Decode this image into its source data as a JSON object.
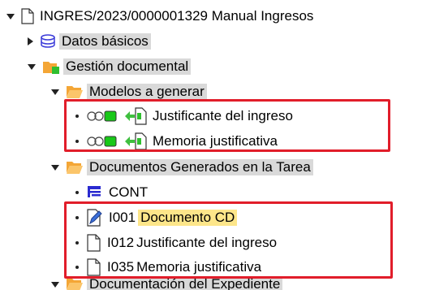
{
  "tree": {
    "root": {
      "label": "INGRES/2023/0000001329 Manual Ingresos",
      "icon": "document-icon"
    },
    "datos_basicos": {
      "label": "Datos básicos",
      "icon": "database-icon"
    },
    "gestion": {
      "label": "Gestión documental",
      "icon": "folder-orange-green-icon"
    },
    "modelos": {
      "label": "Modelos a generar",
      "icon": "folder-open-icon"
    },
    "modelos_items": [
      {
        "label": "Justificante del ingreso",
        "icon": "generate-document-icon"
      },
      {
        "label": "Memoria justificativa",
        "icon": "generate-document-icon"
      }
    ],
    "documentos": {
      "label": "Documentos Generados en la Tarea",
      "icon": "folder-open-icon"
    },
    "cont": {
      "label": "CONT",
      "icon": "list-icon"
    },
    "generados": [
      {
        "label_code": "I001",
        "label_text": "Documento CD",
        "icon": "edit-document-icon"
      },
      {
        "label_code": "I012",
        "label_text": "Justificante del ingreso",
        "icon": "document-icon"
      },
      {
        "label_code": "I035",
        "label_text": "Memoria justificativa",
        "icon": "document-icon"
      }
    ],
    "next_partial": {
      "label": "Documentación del Expediente",
      "icon": "folder-open-icon"
    }
  },
  "colors": {
    "highlight_box": "#e11d2a",
    "selection": "#fde68a",
    "folder": "#f4a636",
    "gray_highlight": "#d9d9d9"
  }
}
